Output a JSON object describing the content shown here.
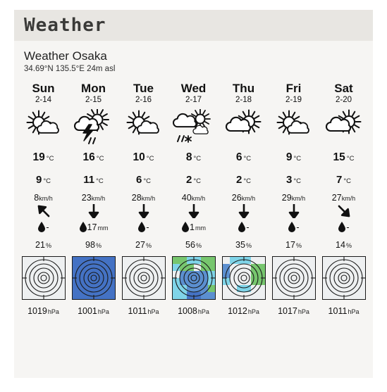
{
  "window": {
    "title": "Weather"
  },
  "location": {
    "name": "Weather Osaka",
    "coords": "34.69°N 135.5°E 24m asl"
  },
  "units": {
    "temperature": "°C",
    "wind": "km/h",
    "precipitation": "mm",
    "percent": "%",
    "pressure": "hPa"
  },
  "colors": {
    "header_bg": "#e8e6e2",
    "page_bg": "#f6f5f3",
    "text": "#111111",
    "map_blue": "#4472c4",
    "map_cyan": "#7fd4e8",
    "map_green": "#77c66e",
    "map_light": "#eef0f1",
    "map_steel": "#5b8fd0"
  },
  "days": [
    {
      "name": "Sun",
      "date": "2-14",
      "icon": "sun-cloud-icon",
      "temp_max": "19",
      "temp_min": "9",
      "wind_speed": "8",
      "wind_dir": "southwest",
      "wind_arrow_rotation": 225,
      "precipitation": "-",
      "precipitation_unit": "",
      "probability": "21",
      "pressure": "1019",
      "map_fill": "light"
    },
    {
      "name": "Mon",
      "date": "2-15",
      "icon": "thunderstorm-icon",
      "temp_max": "16",
      "temp_min": "11",
      "wind_speed": "23",
      "wind_dir": "east",
      "wind_arrow_rotation": 90,
      "precipitation": "17",
      "precipitation_unit": "mm",
      "probability": "98",
      "pressure": "1001",
      "map_fill": "blue"
    },
    {
      "name": "Tue",
      "date": "2-16",
      "icon": "sun-cloud-icon",
      "temp_max": "10",
      "temp_min": "6",
      "wind_speed": "28",
      "wind_dir": "east",
      "wind_arrow_rotation": 90,
      "precipitation": "-",
      "precipitation_unit": "",
      "probability": "27",
      "pressure": "1011",
      "map_fill": "light"
    },
    {
      "name": "Wed",
      "date": "2-17",
      "icon": "sleet-cloud-sun-icon",
      "temp_max": "8",
      "temp_min": "2",
      "wind_speed": "40",
      "wind_dir": "east",
      "wind_arrow_rotation": 90,
      "precipitation": "1",
      "precipitation_unit": "mm",
      "probability": "56",
      "pressure": "1008",
      "map_fill": "mixed-cyan"
    },
    {
      "name": "Thu",
      "date": "2-18",
      "icon": "cloud-sun-icon",
      "temp_max": "6",
      "temp_min": "2",
      "wind_speed": "26",
      "wind_dir": "east",
      "wind_arrow_rotation": 90,
      "precipitation": "-",
      "precipitation_unit": "",
      "probability": "35",
      "pressure": "1012",
      "map_fill": "mixed-light"
    },
    {
      "name": "Fri",
      "date": "2-19",
      "icon": "sun-cloud-icon",
      "temp_max": "9",
      "temp_min": "3",
      "wind_speed": "29",
      "wind_dir": "east",
      "wind_arrow_rotation": 90,
      "precipitation": "-",
      "precipitation_unit": "",
      "probability": "17",
      "pressure": "1017",
      "map_fill": "light"
    },
    {
      "name": "Sat",
      "date": "2-20",
      "icon": "cloud-sun-icon",
      "temp_max": "15",
      "temp_min": "7",
      "wind_speed": "27",
      "wind_dir": "northeast",
      "wind_arrow_rotation": 45,
      "precipitation": "-",
      "precipitation_unit": "",
      "probability": "14",
      "pressure": "1011",
      "map_fill": "light"
    }
  ]
}
